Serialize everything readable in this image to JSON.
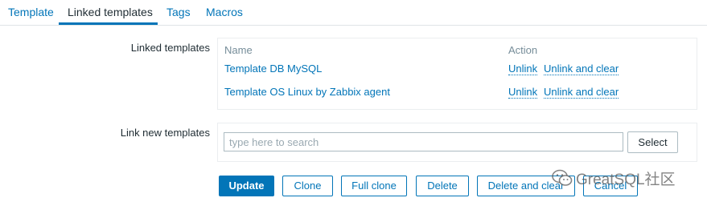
{
  "tabs": [
    {
      "label": "Template",
      "active": false
    },
    {
      "label": "Linked templates",
      "active": true
    },
    {
      "label": "Tags",
      "active": false
    },
    {
      "label": "Macros",
      "active": false
    }
  ],
  "linked_templates": {
    "label": "Linked templates",
    "columns": [
      "Name",
      "Action"
    ],
    "rows": [
      {
        "name": "Template DB MySQL",
        "actions": [
          "Unlink",
          "Unlink and clear"
        ]
      },
      {
        "name": "Template OS Linux by Zabbix agent",
        "actions": [
          "Unlink",
          "Unlink and clear"
        ]
      }
    ]
  },
  "link_new": {
    "label": "Link new templates",
    "placeholder": "type here to search",
    "select_label": "Select"
  },
  "buttons": {
    "update": "Update",
    "clone": "Clone",
    "full_clone": "Full clone",
    "delete": "Delete",
    "delete_and_clear": "Delete and clear",
    "cancel": "Cancel"
  },
  "watermark": {
    "text": "GreatSQL社区",
    "icon": "wechat-icon"
  },
  "colors": {
    "accent": "#0275b8",
    "text": "#1f2c33",
    "muted": "#768d99",
    "border": "#ebeef0"
  }
}
